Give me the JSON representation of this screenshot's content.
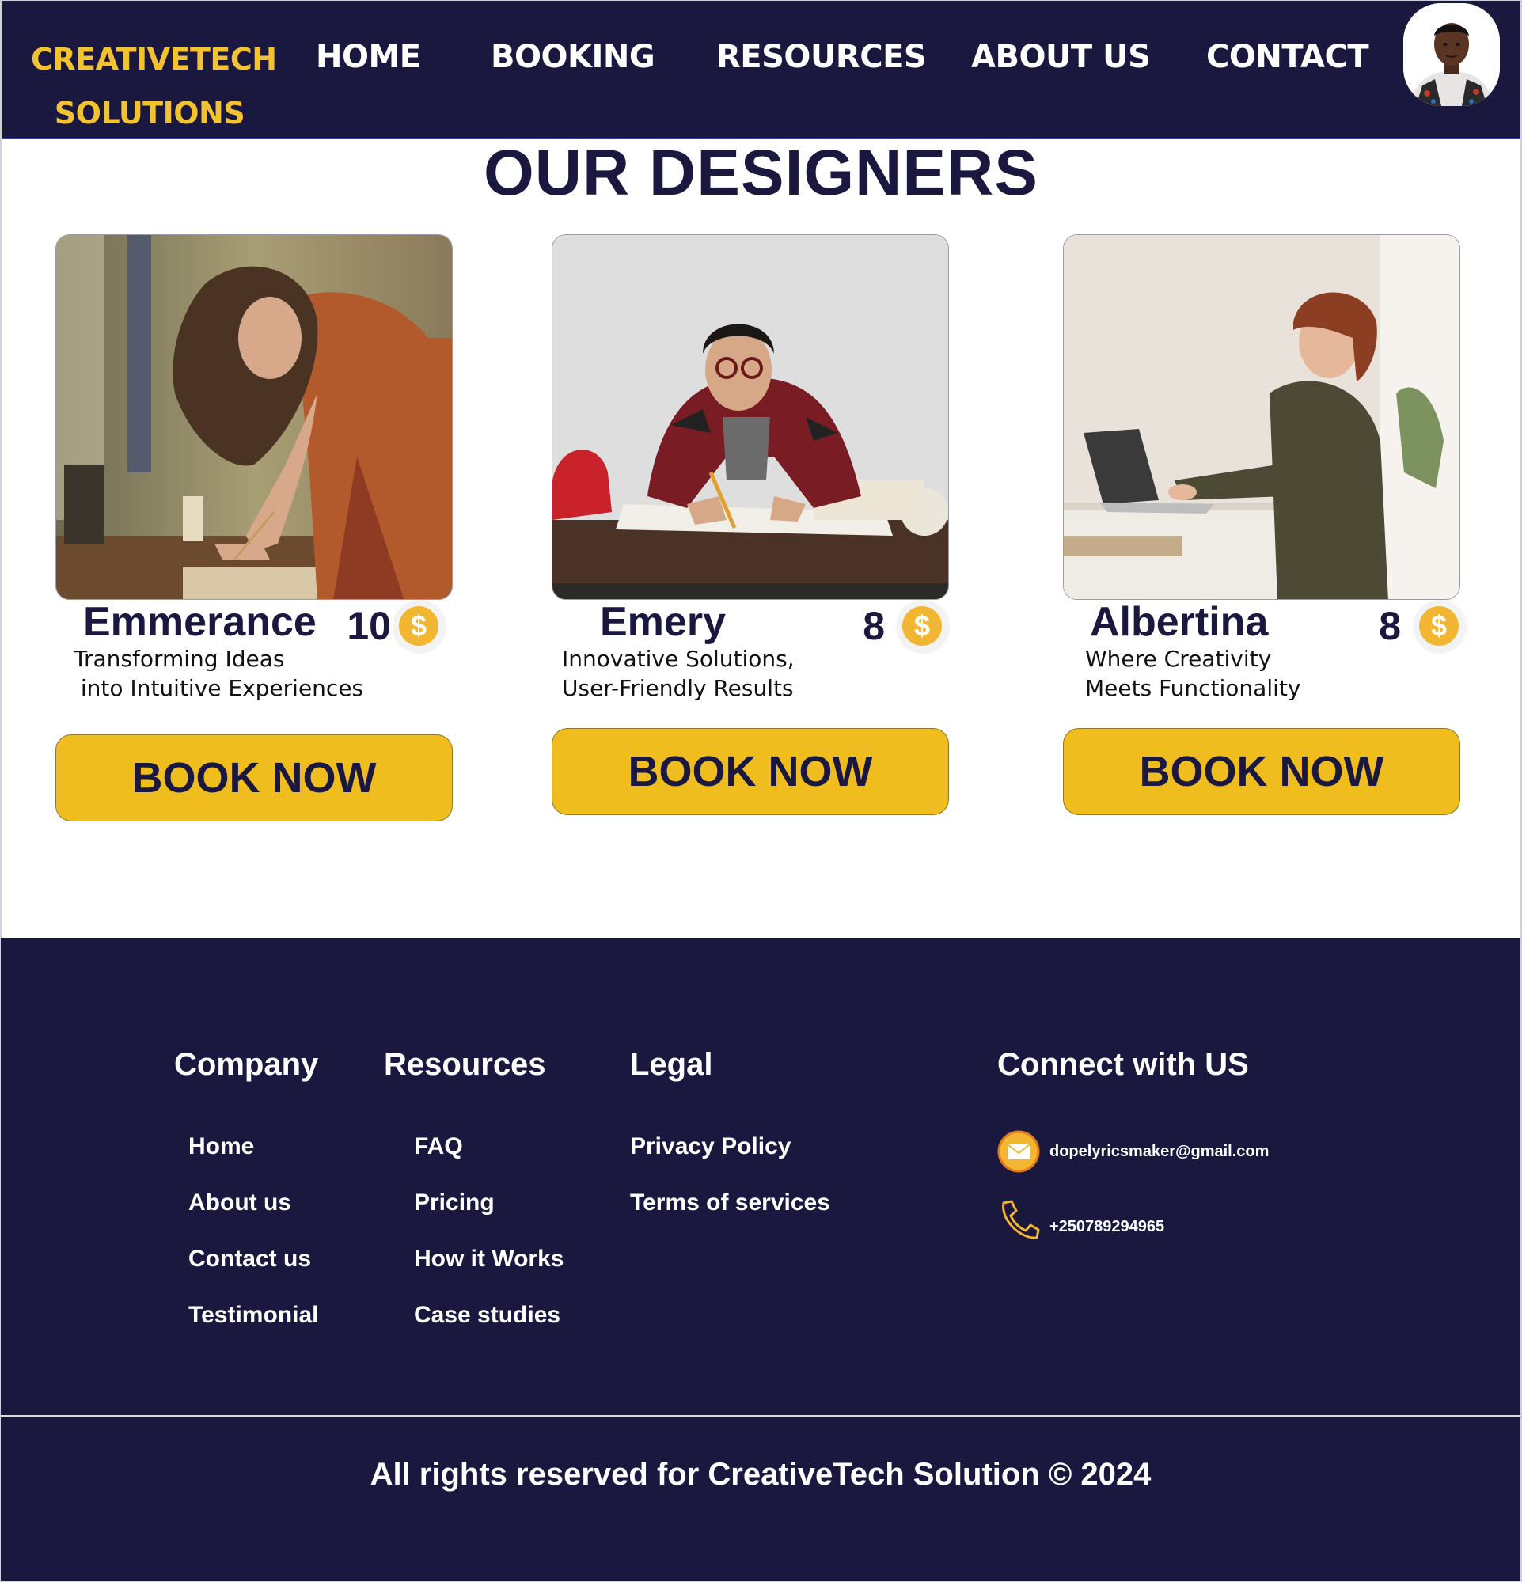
{
  "brand": {
    "line1": "CREATIVETECH",
    "line2": "SOLUTIONS",
    "color": "#f2c230"
  },
  "nav": {
    "items": [
      {
        "label": "HOME"
      },
      {
        "label": "BOOKING"
      },
      {
        "label": "RESOURCES"
      },
      {
        "label": "ABOUT US"
      },
      {
        "label": "CONTACT"
      }
    ]
  },
  "page": {
    "title": "OUR DESIGNERS"
  },
  "designers": [
    {
      "name": "Emmerance",
      "price": "10",
      "currency_icon": "dollar-coin-icon",
      "tagline": "Transforming Ideas\n into Intuitive Experiences",
      "button": "BOOK NOW"
    },
    {
      "name": "Emery",
      "price": "8",
      "currency_icon": "dollar-coin-icon",
      "tagline": "Innovative Solutions,\nUser-Friendly Results",
      "button": "BOOK NOW"
    },
    {
      "name": "Albertina",
      "price": "8",
      "currency_icon": "dollar-coin-icon",
      "tagline": "Where Creativity\nMeets Functionality",
      "button": "BOOK NOW"
    }
  ],
  "footer": {
    "company": {
      "heading": "Company",
      "links": [
        "Home",
        "About us",
        "Contact us",
        "Testimonial"
      ]
    },
    "resources": {
      "heading": "Resources",
      "links": [
        "FAQ",
        "Pricing",
        "How it Works",
        "Case studies"
      ]
    },
    "legal": {
      "heading": "Legal",
      "links": [
        "Privacy Policy",
        "Terms of services"
      ]
    },
    "connect": {
      "heading": "Connect with US",
      "email": "dopelyricsmaker@gmail.com",
      "phone": "+250789294965"
    },
    "copyright": "All rights reserved for CreativeTech Solution © 2024"
  },
  "colors": {
    "navy": "#1b1840",
    "accent_yellow": "#efbd1e",
    "coin_orange": "#f2b632"
  }
}
